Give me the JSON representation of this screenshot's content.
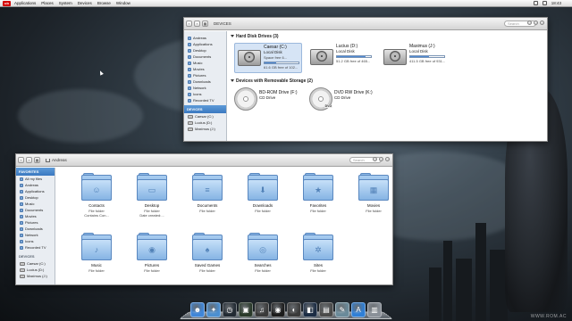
{
  "menubar": {
    "logo": "ub",
    "menus": [
      "Applications",
      "Places",
      "System",
      "Devices",
      "Browse",
      "Window"
    ],
    "clock": "18:43"
  },
  "watermark": "WWW.ROM.AC",
  "devices_window": {
    "breadcrumb": "DEVICES",
    "search_placeholder": "Search",
    "sidebar": {
      "places": [
        "Andreas",
        "Applications",
        "Desktop",
        "Documents",
        "Music",
        "Movies",
        "Pictures",
        "Downloads",
        "Network",
        "Icons",
        "Recorded TV"
      ],
      "devices_header": "DEVICES",
      "devices": [
        "Caesar (C:)",
        "Lucius (D:)",
        "Maximus (J:)"
      ]
    },
    "hard_disk_title": "Hard Disk Drives (3)",
    "drives": [
      {
        "name": "Caesar (C:)",
        "type": "Local Disk",
        "free": "Space free 6...",
        "usage": 0.35,
        "subfree": "61.6 GB free of 102..."
      },
      {
        "name": "Lucius (D:)",
        "type": "Local Disk",
        "free": "51.2 GB free of 465...",
        "usage": 0.85
      },
      {
        "name": "Maximus (J:)",
        "type": "Local Disk",
        "free": "411.5 GB free of 931...",
        "usage": 0.55
      }
    ],
    "removable_title": "Devices with Removable Storage (2)",
    "optical": [
      {
        "name": "BD-ROM Drive (F:)",
        "type": "CD Drive",
        "badge": ""
      },
      {
        "name": "DVD RW Drive (K:)",
        "type": "CD Drive",
        "badge": "DVD"
      }
    ]
  },
  "home_window": {
    "breadcrumb": "Andreas",
    "search_placeholder": "Search",
    "sidebar": {
      "favorites_header": "FAVORITES",
      "places": [
        "All my files",
        "Andreas",
        "Applications",
        "Desktop",
        "Music",
        "Documents",
        "Movies",
        "Pictures",
        "Downloads",
        "Network",
        "Icons",
        "Recorded TV"
      ],
      "devices_header": "DEVICES",
      "devices": [
        "Caesar (C:)",
        "Lucius (D:)",
        "Maximus (J:)"
      ]
    },
    "folders": [
      {
        "name": "Contacts",
        "type": "File folder",
        "extra": "Contains Con...",
        "glyph": "☺"
      },
      {
        "name": "Desktop",
        "type": "File folder",
        "extra": "Date created:...",
        "glyph": "▭"
      },
      {
        "name": "Documents",
        "type": "File folder",
        "extra": "",
        "glyph": "≡"
      },
      {
        "name": "Downloads",
        "type": "File folder",
        "extra": "",
        "glyph": "⬇"
      },
      {
        "name": "Favorites",
        "type": "File folder",
        "extra": "",
        "glyph": "★"
      },
      {
        "name": "Movies",
        "type": "File folder",
        "extra": "",
        "glyph": "▦"
      },
      {
        "name": "Music",
        "type": "File folder",
        "extra": "",
        "glyph": "♪"
      },
      {
        "name": "Pictures",
        "type": "File folder",
        "extra": "",
        "glyph": "◉"
      },
      {
        "name": "Saved Games",
        "type": "File folder",
        "extra": "",
        "glyph": "♠"
      },
      {
        "name": "Searches",
        "type": "File folder",
        "extra": "",
        "glyph": "◎"
      },
      {
        "name": "Sites",
        "type": "File folder",
        "extra": "",
        "glyph": "✲"
      }
    ]
  },
  "dock": {
    "apps": [
      {
        "name": "finder",
        "glyph": "☻",
        "color": "#3f86d8"
      },
      {
        "name": "safari",
        "glyph": "✦",
        "color": "#4c8fd0"
      },
      {
        "name": "dashboard",
        "glyph": "◷",
        "color": "#222a33"
      },
      {
        "name": "photos",
        "glyph": "▣",
        "color": "#2a3a2a"
      },
      {
        "name": "itunes",
        "glyph": "♫",
        "color": "#3a3a3a"
      },
      {
        "name": "quicktime",
        "glyph": "◉",
        "color": "#1c1c1c"
      },
      {
        "name": "dvd-player",
        "glyph": "◐",
        "color": "#3a3a3a"
      },
      {
        "name": "mission-control",
        "glyph": "◧",
        "color": "#1b2c44"
      },
      {
        "name": "terminal",
        "glyph": "▤",
        "color": "#4a4a4a"
      },
      {
        "name": "text-edit",
        "glyph": "✎",
        "color": "#6a8a9a"
      },
      {
        "name": "app-store",
        "glyph": "A",
        "color": "#2f7fd6"
      },
      {
        "name": "trash",
        "glyph": "▥",
        "color": "#8a9098"
      }
    ]
  }
}
